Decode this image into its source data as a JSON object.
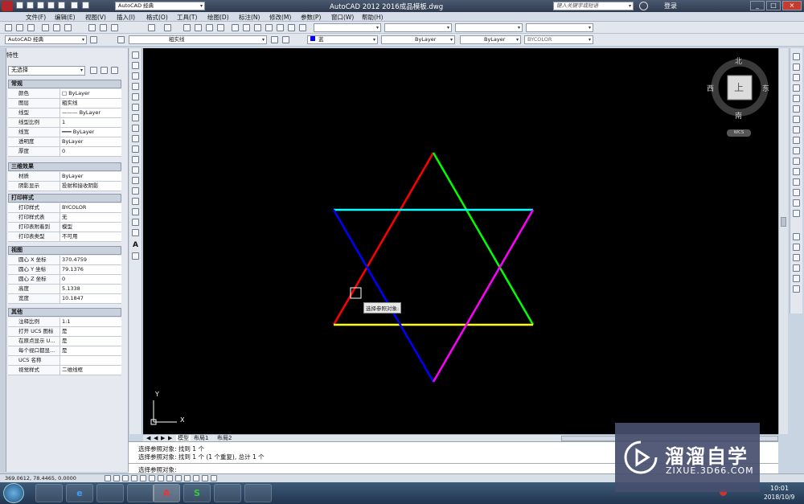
{
  "title": {
    "app_menu": "AutoCAD 经典",
    "window_title": "AutoCAD 2012    2016成品模板.dwg",
    "search_placeholder": "键入关键字或短语",
    "login": "登录"
  },
  "menus": [
    "文件(F)",
    "编辑(E)",
    "视图(V)",
    "插入(I)",
    "格式(O)",
    "工具(T)",
    "绘图(D)",
    "标注(N)",
    "修改(M)",
    "参数(P)",
    "窗口(W)",
    "帮助(H)"
  ],
  "toolbar": {
    "workspace": "AutoCAD 经典",
    "layer": "粗实线",
    "color": "蓝",
    "linetype": "ByLayer",
    "lineweight": "ByLayer",
    "plotstyle": "BYCOLOR"
  },
  "props": {
    "header": "特性",
    "selector": "无选择",
    "sections": {
      "general": "常规",
      "threed": "三维效果",
      "plot": "打印样式",
      "view": "视图",
      "misc": "其他"
    },
    "general": [
      {
        "k": "颜色",
        "v": "□ ByLayer"
      },
      {
        "k": "图层",
        "v": "粗实线"
      },
      {
        "k": "线型",
        "v": "——— ByLayer"
      },
      {
        "k": "线型比例",
        "v": "1"
      },
      {
        "k": "线宽",
        "v": "━━━ ByLayer"
      },
      {
        "k": "透明度",
        "v": "ByLayer"
      },
      {
        "k": "厚度",
        "v": "0"
      }
    ],
    "threed": [
      {
        "k": "材质",
        "v": "ByLayer"
      },
      {
        "k": "阴影显示",
        "v": "投射和接收阴影"
      }
    ],
    "plot": [
      {
        "k": "打印样式",
        "v": "BYCOLOR"
      },
      {
        "k": "打印样式表",
        "v": "无"
      },
      {
        "k": "打印表附着到",
        "v": "模型"
      },
      {
        "k": "打印表类型",
        "v": "不可用"
      }
    ],
    "view": [
      {
        "k": "圆心 X 坐标",
        "v": "370.4759"
      },
      {
        "k": "圆心 Y 坐标",
        "v": "79.1376"
      },
      {
        "k": "圆心 Z 坐标",
        "v": "0"
      },
      {
        "k": "高度",
        "v": "5.1338"
      },
      {
        "k": "宽度",
        "v": "10.1847"
      }
    ],
    "misc": [
      {
        "k": "注释比例",
        "v": "1:1"
      },
      {
        "k": "打开 UCS 图标",
        "v": "是"
      },
      {
        "k": "在原点显示 U...",
        "v": "是"
      },
      {
        "k": "每个视口都显...",
        "v": "是"
      },
      {
        "k": "UCS 名称",
        "v": ""
      },
      {
        "k": "视觉样式",
        "v": "二维线框"
      }
    ]
  },
  "viewcube": {
    "north": "北",
    "south": "南",
    "east": "东",
    "west": "西",
    "top": "上",
    "ucs": "WCS"
  },
  "tooltip": "选择参照对象:",
  "ucs_axes": {
    "x": "X",
    "y": "Y"
  },
  "layout_tabs": [
    "模型",
    "布局1",
    "布局2"
  ],
  "command_lines": [
    "选择参照对象: 找到 1 个",
    "选择参照对象: 找到 1 个 (1 个重复), 总计 1 个",
    "选择参照对象:"
  ],
  "status_coords": "369.0612, 78.4465, 0.0000",
  "clock": {
    "time": "10:01",
    "date": "2018/10/9"
  },
  "watermark": {
    "brand": "溜溜自学",
    "url": "ZIXUE.3D66.COM"
  },
  "colors": {
    "red": "#ff0000",
    "green": "#00ff00",
    "cyan": "#00ffff",
    "magenta": "#ff00ff",
    "blue": "#0000ff",
    "yellow": "#ffff00"
  }
}
